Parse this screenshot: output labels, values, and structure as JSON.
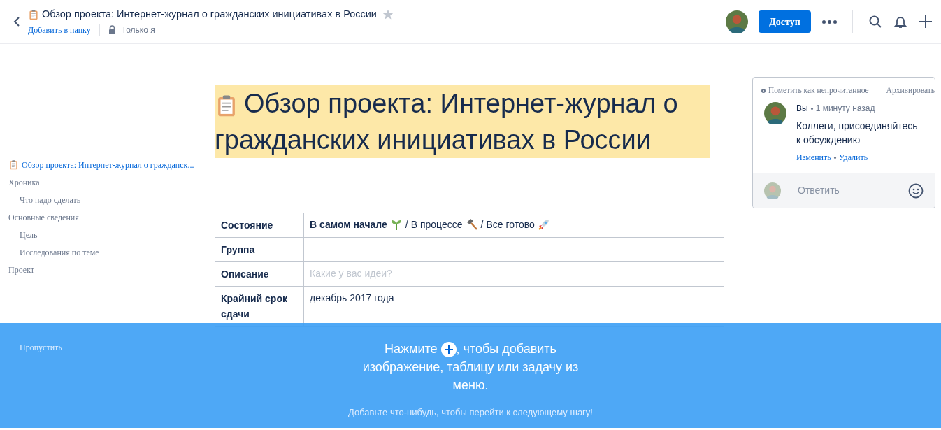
{
  "header": {
    "title": "Обзор проекта: Интернет-журнал о гражданских инициативах в России",
    "starred": false,
    "add_to_folder": "Добавить в папку",
    "visibility": "Только я",
    "share_button": "Доступ"
  },
  "toc": [
    {
      "label": "Обзор проекта: Интернет-журнал о гражданск...",
      "selected": true
    },
    {
      "label": "Хроника",
      "selected": false,
      "children": [
        {
          "label": "Что надо сделать",
          "selected": false
        }
      ]
    },
    {
      "label": "Основные сведения",
      "selected": false,
      "children": [
        {
          "label": "Цель",
          "selected": false
        },
        {
          "label": "Исследования по теме",
          "selected": false
        }
      ]
    },
    {
      "label": "Проект",
      "selected": false
    }
  ],
  "document": {
    "title": "Обзор проекта: Интернет-журнал о гражданских инициативах в России",
    "highlighted": true,
    "table": [
      {
        "label": "Состояние",
        "kind": "status",
        "separator": "/",
        "options": [
          {
            "label": "В самом начале",
            "selected": true
          },
          {
            "label": "В процессе",
            "selected": false
          },
          {
            "label": "Все готово",
            "selected": false
          }
        ]
      },
      {
        "label": "Группа",
        "kind": "text"
      },
      {
        "label": "Описание",
        "kind": "placeholder",
        "placeholder": "Какие у вас идеи?"
      },
      {
        "label": "Крайний срок сдачи",
        "kind": "text",
        "value": "декабрь 2017 года"
      }
    ]
  },
  "comment": {
    "mark_unread": "Пометить как непрочитанное",
    "archive": "Архивировать",
    "author": "Вы",
    "time": "1 минуту назад",
    "text": "Коллеги, присоединяйтесь к обсуждению",
    "edit": "Изменить",
    "delete": "Удалить",
    "reply_placeholder": "Ответить"
  },
  "onboarding": {
    "skip": "Пропустить",
    "message_before": "Нажмите",
    "message_after": ", чтобы добавить изображение, таблицу или задачу из меню.",
    "hint": "Добавьте что-нибудь, чтобы перейти к следующему шагу!"
  }
}
